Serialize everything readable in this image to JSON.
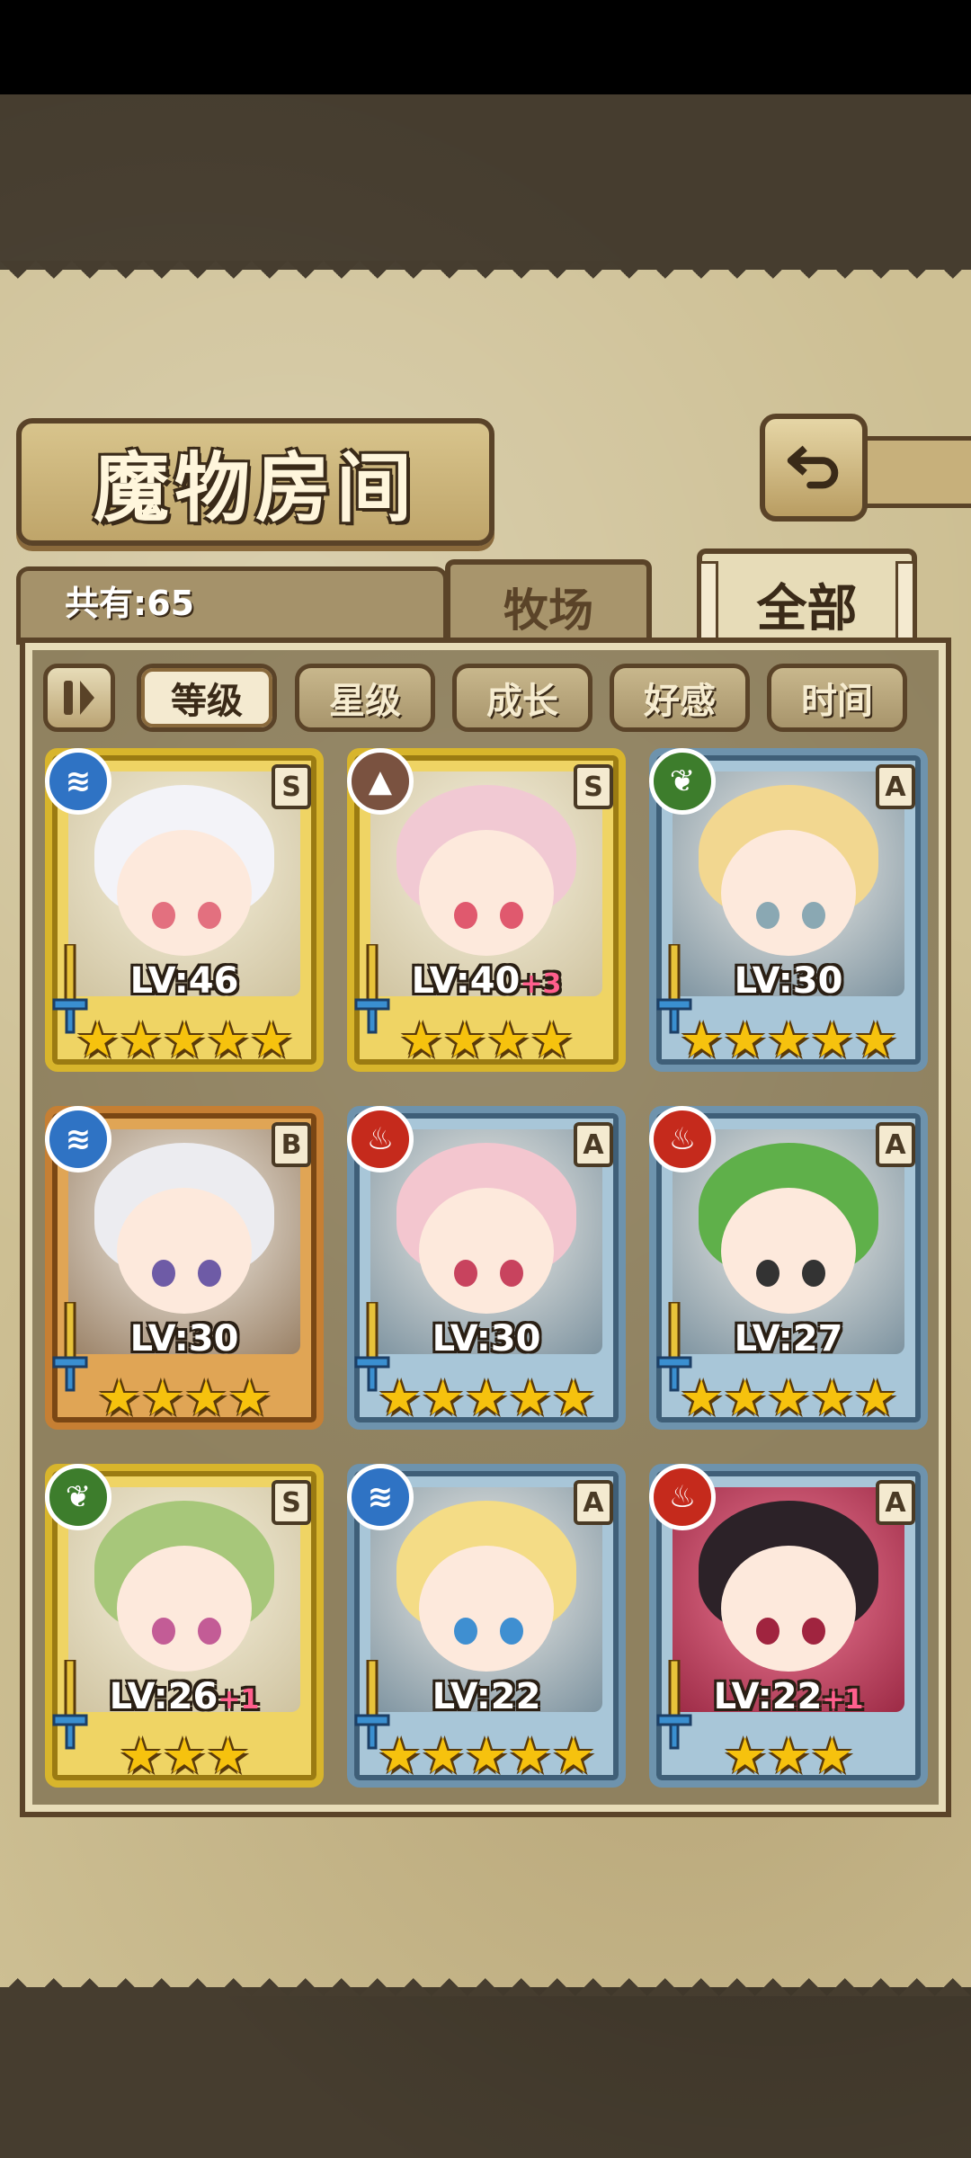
{
  "title": "魔物房间",
  "count_label": "共有:65",
  "tabs": {
    "ranch": "牧场",
    "all": "全部"
  },
  "filters": [
    "等级",
    "星级",
    "成长",
    "好感",
    "时间"
  ],
  "active_filter": "等级",
  "monsters": [
    {
      "element": "water",
      "rank": "S",
      "level": "LV:46",
      "bonus": "",
      "stars": "★★★★★",
      "frame": "gold",
      "hair": "#f3f3f8",
      "eye": "#e3707f"
    },
    {
      "element": "earth",
      "rank": "S",
      "level": "LV:40",
      "bonus": "+3",
      "stars": "★★★★",
      "frame": "gold",
      "hair": "#f1c9d3",
      "eye": "#e0596e"
    },
    {
      "element": "leaf",
      "rank": "A",
      "level": "LV:30",
      "bonus": "",
      "stars": "★★★★★",
      "frame": "blue",
      "hair": "#f2d790",
      "eye": "#8aa8b3"
    },
    {
      "element": "water",
      "rank": "B",
      "level": "LV:30",
      "bonus": "",
      "stars": "★★★★",
      "frame": "bronze",
      "hair": "#ececf0",
      "eye": "#6e5ba6"
    },
    {
      "element": "fire",
      "rank": "A",
      "level": "LV:30",
      "bonus": "",
      "stars": "★★★★★",
      "frame": "blue",
      "hair": "#f3c6cf",
      "eye": "#c8435e"
    },
    {
      "element": "fire",
      "rank": "A",
      "level": "LV:27",
      "bonus": "",
      "stars": "★★★★★",
      "frame": "blue",
      "hair": "#5fb04a",
      "eye": "#333333"
    },
    {
      "element": "leaf",
      "rank": "S",
      "level": "LV:26",
      "bonus": "+1",
      "stars": "★★★",
      "frame": "gold",
      "hair": "#a7c77a",
      "eye": "#c35c96"
    },
    {
      "element": "water",
      "rank": "A",
      "level": "LV:22",
      "bonus": "",
      "stars": "★★★★★",
      "frame": "blue",
      "hair": "#f4dc86",
      "eye": "#3f8fd1"
    },
    {
      "element": "fire",
      "rank": "A",
      "level": "LV:22",
      "bonus": "+1",
      "stars": "★★★",
      "frame": "blue",
      "hair": "#2c2228",
      "eye": "#a0243f"
    }
  ],
  "element_icons": {
    "water": "water-element-icon",
    "fire": "fire-element-icon",
    "leaf": "leaf-element-icon",
    "earth": "earth-element-icon"
  }
}
